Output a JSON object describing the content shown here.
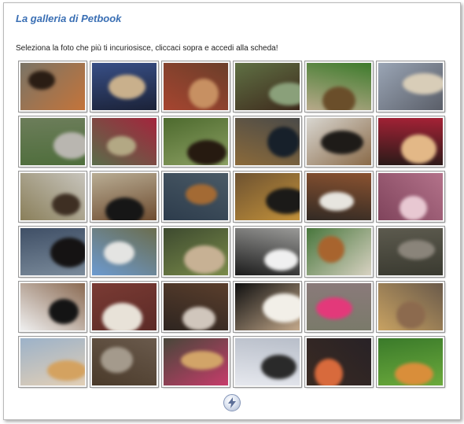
{
  "header": {
    "title": "La galleria di Petbook"
  },
  "instructions": "Seleziona la foto che più ti incuriosisce, cliccaci sopra e accedi alla scheda!",
  "gallery": {
    "photos": [
      {
        "subject": "dog",
        "bg": "#7a7466",
        "a": "#2a1d14",
        "b": "#c4743a"
      },
      {
        "subject": "dog",
        "bg": "#384f86",
        "a": "#c9b08c",
        "b": "#1b2238"
      },
      {
        "subject": "cat",
        "bg": "#6b3e2a",
        "a": "#c79062",
        "b": "#a64530"
      },
      {
        "subject": "dog",
        "bg": "#5f7044",
        "a": "#8aa07a",
        "b": "#3e2a1c"
      },
      {
        "subject": "dog",
        "bg": "#3d7b2c",
        "a": "#6a4e2a",
        "b": "#b8a98a"
      },
      {
        "subject": "dog",
        "bg": "#9aa5b5",
        "a": "#d8cdb8",
        "b": "#5a5e68"
      },
      {
        "subject": "dog",
        "bg": "#6c7d5a",
        "a": "#b9b6b0",
        "b": "#4f6e3c"
      },
      {
        "subject": "dog",
        "bg": "#a3253c",
        "a": "#b3a884",
        "b": "#5a6d4a"
      },
      {
        "subject": "dog",
        "bg": "#4d6a2e",
        "a": "#261a10",
        "b": "#8ca063"
      },
      {
        "subject": "dog",
        "bg": "#4a4a48",
        "a": "#17202a",
        "b": "#8b6a3a"
      },
      {
        "subject": "dog",
        "bg": "#d8d6d0",
        "a": "#1e1b18",
        "b": "#8a6a48"
      },
      {
        "subject": "cat",
        "bg": "#a52236",
        "a": "#e3b887",
        "b": "#2a1a18"
      },
      {
        "subject": "dog",
        "bg": "#c7c4bc",
        "a": "#3e2f23",
        "b": "#8a7f5a"
      },
      {
        "subject": "dog",
        "bg": "#b9ad94",
        "a": "#161616",
        "b": "#6e4c30"
      },
      {
        "subject": "dog",
        "bg": "#4a5a66",
        "a": "#a36a34",
        "b": "#2d3c4c"
      },
      {
        "subject": "dog",
        "bg": "#6d5231",
        "a": "#1b1a18",
        "b": "#c4923a"
      },
      {
        "subject": "cat",
        "bg": "#8a5230",
        "a": "#e7e5df",
        "b": "#322a24"
      },
      {
        "subject": "cat",
        "bg": "#b3728a",
        "a": "#e8c8d2",
        "b": "#80445c"
      },
      {
        "subject": "dog",
        "bg": "#3f4f66",
        "a": "#151313",
        "b": "#7a8a9a"
      },
      {
        "subject": "dog",
        "bg": "#6b6d4e",
        "a": "#e4e4e2",
        "b": "#6c9ad0"
      },
      {
        "subject": "cat",
        "bg": "#3d4a2f",
        "a": "#c7b194",
        "b": "#7a8b4a"
      },
      {
        "subject": "cat",
        "bg": "#9a9a98",
        "a": "#f0f0f0",
        "b": "#1c1c1c"
      },
      {
        "subject": "dog",
        "bg": "#48763c",
        "a": "#a8642e",
        "b": "#d8d2c2"
      },
      {
        "subject": "cat",
        "bg": "#5c5a4e",
        "a": "#8a847a",
        "b": "#3a3a30"
      },
      {
        "subject": "dog",
        "bg": "#8a6a52",
        "a": "#141414",
        "b": "#efefef"
      },
      {
        "subject": "dog",
        "bg": "#7a3b34",
        "a": "#e8e2d8",
        "b": "#5c2a26"
      },
      {
        "subject": "cat",
        "bg": "#5a3e2c",
        "a": "#d0c6bc",
        "b": "#2e2520"
      },
      {
        "subject": "dog",
        "bg": "#101010",
        "a": "#f2efe8",
        "b": "#c3a88a"
      },
      {
        "subject": "cat",
        "bg": "#8a7a7a",
        "a": "#e3397a",
        "b": "#7a7a6a"
      },
      {
        "subject": "dog",
        "bg": "#6a5a4a",
        "a": "#8c6a4e",
        "b": "#c8a262"
      },
      {
        "subject": "cat",
        "bg": "#9cb2c9",
        "a": "#d4a260",
        "b": "#e2cfb6"
      },
      {
        "subject": "cat",
        "bg": "#6a5a4c",
        "a": "#a49a8c",
        "b": "#4a3a2a"
      },
      {
        "subject": "dog",
        "bg": "#48473a",
        "a": "#d2a468",
        "b": "#c63c6a"
      },
      {
        "subject": "dog",
        "bg": "#b8bec9",
        "a": "#2a2a2a",
        "b": "#e6e8ee"
      },
      {
        "subject": "dog",
        "bg": "#282226",
        "a": "#d86a3c",
        "b": "#3a2a22"
      },
      {
        "subject": "cat",
        "bg": "#3a7a2a",
        "a": "#d98e3a",
        "b": "#6caa3c"
      }
    ]
  },
  "nav": {
    "icon": "lightning-icon"
  }
}
